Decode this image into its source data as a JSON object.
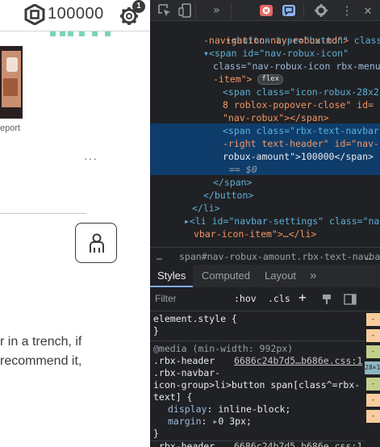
{
  "header": {
    "robux_amount": "100000",
    "notification_count": "1"
  },
  "left_page": {
    "report_label": "eport",
    "more_label": "···",
    "review_lines": [
      "r in a trench, if",
      "recommend it,"
    ]
  },
  "devtools": {
    "dom_lines": [
      "▾<button type=\"button\" class=\"btn",
      "-navigation-nav-robux-md\">",
      "▾<span id=\"nav-robux-icon\"",
      "class=\"nav-robux-icon rbx-menu",
      "-item\">",
      "<span class=\"icon-robux-28x2",
      "8 roblox-popover-close\" id=",
      "\"nav-robux\"></span>",
      "<span class=\"rbx-text-navbar",
      "-right text-header\" id=\"nav-",
      "robux-amount\">100000</span>",
      "== $0",
      "</span>",
      "</button>",
      "</li>",
      "▸<li id=\"navbar-settings\" class=\"na",
      "vbar-icon-item\">…</li>"
    ],
    "flex_badge": "flex",
    "breadcrumb": "span#nav-robux-amount.rbx-text-navba",
    "breadcrumb_more": "…",
    "tabs": {
      "styles": "Styles",
      "computed": "Computed",
      "layout": "Layout",
      "more": "»"
    },
    "filter": {
      "placeholder": "Filter",
      "hov": ":hov",
      "cls": ".cls",
      "plus": "+"
    },
    "rules": {
      "element_style": "element.style {",
      "close1": "}",
      "media": "@media (min-width: 992px)",
      "sel1": ".rbx-header",
      "source1": "6686c24b7d5…b686e.css:1",
      "sel2": ".rbx-navbar-",
      "sel3": "icon-group>li>button span[class^=rbx-",
      "sel4": "text] {",
      "prop1": "display",
      "val1": "inline-block;",
      "prop2": "margin",
      "val2": "0 3px;",
      "close2": "}",
      "sel5": ".rbx-header",
      "source2": "6686c24b7d5…b686e.css:1"
    },
    "box_model_label": "28×1"
  },
  "colors": {
    "accent_blue": "#7cacf8",
    "selected_row": "#0f3d6b",
    "devtools_bg": "#202124"
  }
}
